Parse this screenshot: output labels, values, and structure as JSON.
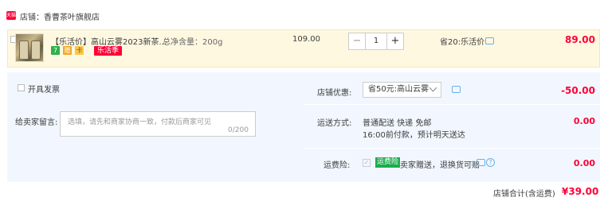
{
  "store": {
    "badge": "天猫",
    "label": "店铺：香曹茶叶旗舰店"
  },
  "item": {
    "title": "【乐活价】高山云雾2023新茶...",
    "sku": "总净含量：200g",
    "icon_badges": [
      "7",
      "赠",
      "卡"
    ],
    "promo_tag": "乐活季",
    "unit_price": "109.00",
    "quantity": "1",
    "save_note": "省20:乐活价",
    "total": "89.00"
  },
  "invoice": {
    "label": "开具发票"
  },
  "message": {
    "label": "给卖家留言:",
    "placeholder": "选填，请先和商家协商一致，付款后商家可见",
    "counter": "0/200"
  },
  "coupon": {
    "label": "店铺优惠:",
    "selected": "省50元:高山云雾",
    "discount": "-50.00"
  },
  "shipping": {
    "label": "运送方式:",
    "line1": "普通配送 快递 免邮",
    "line2": "16:00前付款，预计明天送达",
    "fee": "0.00"
  },
  "insurance": {
    "label": "运费险:",
    "badge": "运费险",
    "text": "卖家赠送，退换货可赔",
    "fee": "0.00"
  },
  "footer": {
    "label": "店铺合计(含运费)",
    "total": "¥39.00"
  }
}
